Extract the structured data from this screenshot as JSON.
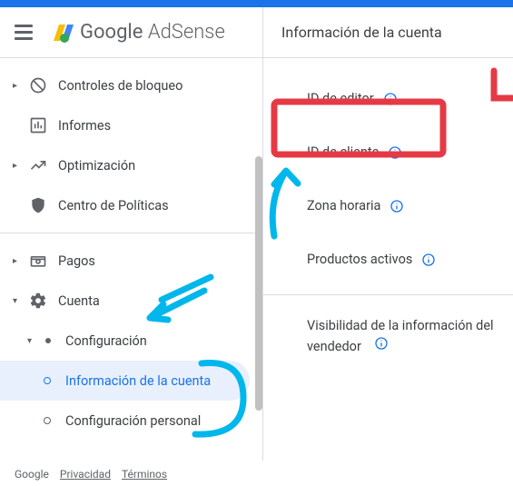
{
  "header": {
    "logo_prefix": "Google",
    "logo_suffix": " AdSense",
    "title": "Información de la cuenta"
  },
  "sidebar": {
    "items": [
      {
        "label": "Controles de bloqueo"
      },
      {
        "label": "Informes"
      },
      {
        "label": "Optimización"
      },
      {
        "label": "Centro de Políticas"
      },
      {
        "label": "Pagos"
      },
      {
        "label": "Cuenta"
      },
      {
        "label": "Configuración"
      },
      {
        "label": "Información de la cuenta"
      },
      {
        "label": "Configuración personal"
      }
    ]
  },
  "main": {
    "fields": [
      {
        "label": "ID de editor"
      },
      {
        "label": "ID de cliente"
      },
      {
        "label": "Zona horaria"
      },
      {
        "label": "Productos activos"
      },
      {
        "label": "Visibilidad de la información del vendedor"
      }
    ]
  },
  "footer": {
    "brand": "Google",
    "privacy": "Privacidad",
    "terms": "Términos"
  }
}
